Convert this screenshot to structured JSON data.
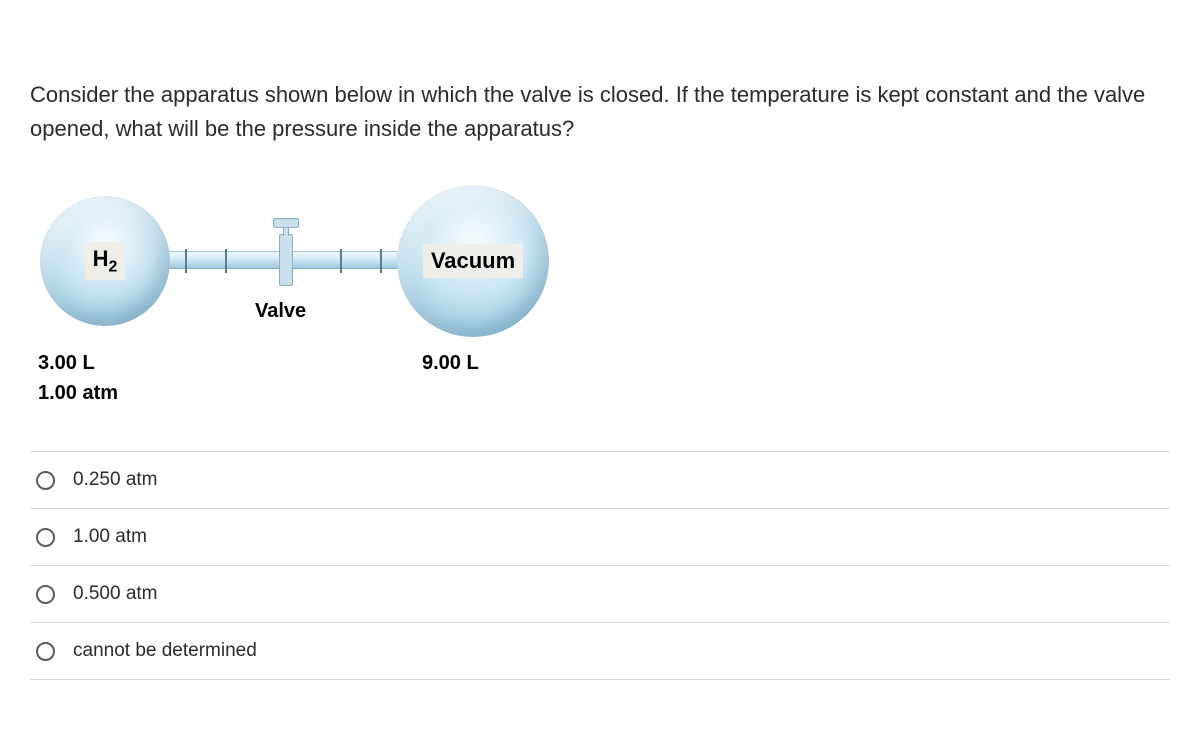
{
  "question": "Consider the apparatus shown below in which the valve is closed. If the temperature is kept constant and the valve opened, what will be the pressure inside the apparatus?",
  "apparatus": {
    "left_bulb_gas": "H",
    "left_bulb_gas_sub": "2",
    "right_bulb_label": "Vacuum",
    "valve_label": "Valve",
    "left_volume": "3.00 L",
    "left_pressure": "1.00 atm",
    "right_volume": "9.00 L"
  },
  "options": [
    {
      "label": "0.250 atm"
    },
    {
      "label": "1.00 atm"
    },
    {
      "label": "0.500 atm"
    },
    {
      "label": "cannot be determined"
    }
  ]
}
